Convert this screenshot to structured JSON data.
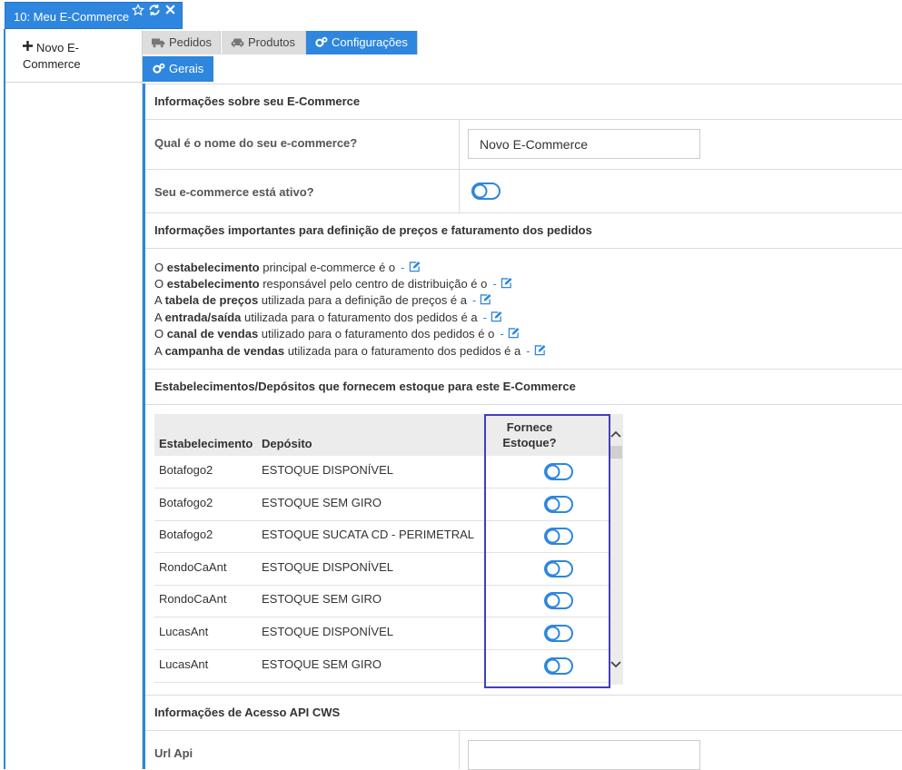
{
  "window": {
    "title": "10: Meu E-Commerce",
    "star_icon": "star-outline-icon",
    "refresh_icon": "refresh-icon",
    "close_icon": "close-icon"
  },
  "left_panel": {
    "new_item_label": "Novo E-Commerce",
    "plus_icon": "plus-icon"
  },
  "tabs": [
    {
      "label": "Pedidos",
      "icon": "truck-icon",
      "active": false
    },
    {
      "label": "Produtos",
      "icon": "car-icon",
      "active": false
    },
    {
      "label": "Configurações",
      "icon": "gears-icon",
      "active": true
    }
  ],
  "subtabs": [
    {
      "label": "Gerais",
      "icon": "gears-icon",
      "active": true
    }
  ],
  "sections": {
    "ecommerce_info": {
      "title": "Informações sobre seu E-Commerce",
      "name_label": "Qual é o nome do seu e-commerce?",
      "name_value": "Novo E-Commerce",
      "active_label": "Seu e-commerce está ativo?"
    },
    "pricing_info": {
      "title": "Informações importantes para definição de preços e faturamento dos pedidos",
      "lines": [
        {
          "pre": "O ",
          "bold": "estabelecimento",
          "post": " principal e-commerce é o",
          "dash": "-"
        },
        {
          "pre": "O ",
          "bold": "estabelecimento",
          "post": " responsável pelo centro de distribuição é o",
          "dash": "-"
        },
        {
          "pre": "A ",
          "bold": "tabela de preços",
          "post": " utilizada para a definição de preços é a",
          "dash": "-"
        },
        {
          "pre": "A ",
          "bold": "entrada/saída",
          "post": " utilizada para o faturamento dos pedidos é a",
          "dash": "-"
        },
        {
          "pre": "O ",
          "bold": "canal de vendas",
          "post": " utilizado para o faturamento dos pedidos é o",
          "dash": "-"
        },
        {
          "pre": "A ",
          "bold": "campanha de vendas",
          "post": " utilizada para o faturamento dos pedidos é a",
          "dash": "-"
        }
      ]
    },
    "stock": {
      "title": "Estabelecimentos/Depósitos que fornecem estoque para este E-Commerce",
      "columns": [
        "Estabelecimento",
        "Depósito",
        "Fornece Estoque?"
      ],
      "rows": [
        {
          "estabelecimento": "Botafogo2",
          "deposito": "ESTOQUE DISPONÍVEL"
        },
        {
          "estabelecimento": "Botafogo2",
          "deposito": "ESTOQUE SEM GIRO"
        },
        {
          "estabelecimento": "Botafogo2",
          "deposito": "ESTOQUE SUCATA CD - PERIMETRAL"
        },
        {
          "estabelecimento": "RondoCaAnt",
          "deposito": "ESTOQUE DISPONÍVEL"
        },
        {
          "estabelecimento": "RondoCaAnt",
          "deposito": "ESTOQUE SEM GIRO"
        },
        {
          "estabelecimento": "LucasAnt",
          "deposito": "ESTOQUE DISPONÍVEL"
        },
        {
          "estabelecimento": "LucasAnt",
          "deposito": "ESTOQUE SEM GIRO"
        }
      ]
    },
    "api": {
      "title": "Informações de Acesso API CWS",
      "url_label": "Url Api",
      "url_value": ""
    }
  },
  "colors": {
    "accent": "#2e86de",
    "highlight_box": "#3f3fbf"
  }
}
